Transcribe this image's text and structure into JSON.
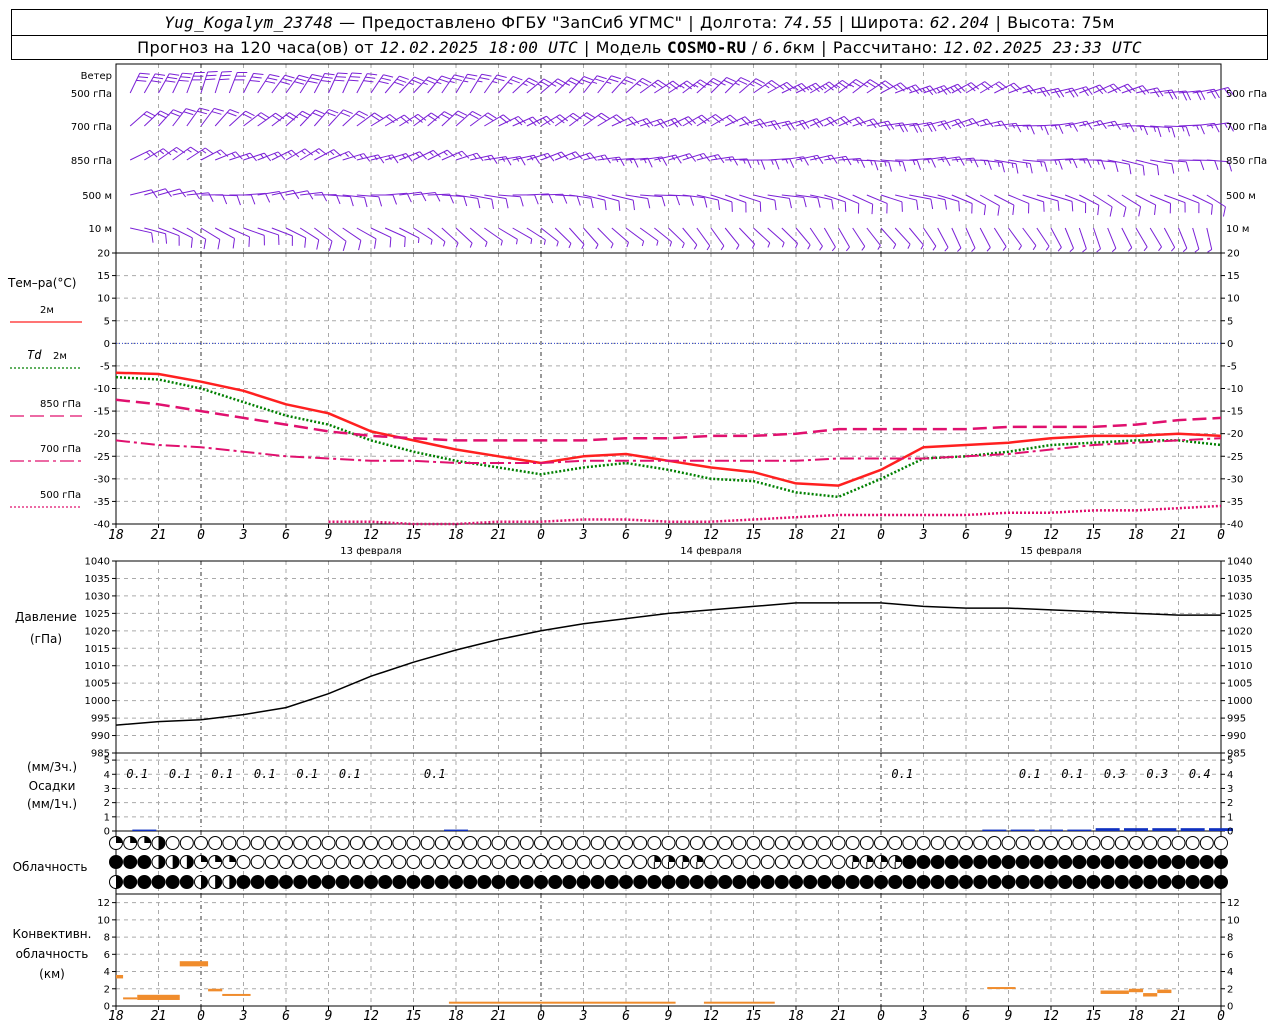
{
  "header": {
    "station": "Yug_Kogalym_23748",
    "dash": "—",
    "provider": "Предоставлено ФГБУ \"ЗапСиб УГМС\"",
    "lon_label": "Долгота:",
    "lon_value": "74.55",
    "lat_label": "Широта:",
    "lat_value": "62.204",
    "alt_label": "Высота:",
    "alt_value": "75м",
    "forecast_prefix": "Прогноз на 120 часа(ов) от",
    "forecast_time": "12.02.2025 18:00 UTC",
    "model_label": "Модель",
    "model_name": "COSMO-RU",
    "model_res": "6.6",
    "model_res_unit": "км",
    "calc_label": "Рассчитано:",
    "calc_time": "12.02.2025 23:33 UTC"
  },
  "x_axis": {
    "hour_labels": [
      "18",
      "21",
      "0",
      "3",
      "6",
      "9",
      "12",
      "15",
      "18",
      "21",
      "0",
      "3",
      "6",
      "9",
      "12",
      "15",
      "18",
      "21",
      "0",
      "3",
      "6",
      "9",
      "12",
      "15",
      "18",
      "21",
      "0"
    ],
    "day_labels": [
      {
        "text": "13 февраля",
        "at_index": 6
      },
      {
        "text": "14 февраля",
        "at_index": 14
      },
      {
        "text": "15 февраля",
        "at_index": 22
      }
    ]
  },
  "wind_panel": {
    "title": "Ветер",
    "levels": [
      "500 гПа",
      "700 гПа",
      "850 гПа",
      "500 м",
      "10  м"
    ]
  },
  "temp_panel": {
    "title": "Тем–ра(°C)",
    "legend": [
      {
        "label": "2м",
        "color": "#ff2020",
        "style": "solid"
      },
      {
        "label_main": "Td",
        "label": "2м",
        "color": "#008000",
        "style": "dotted"
      },
      {
        "label": "850 гПа",
        "color": "#e0106e",
        "style": "dashed"
      },
      {
        "label": "700 гПа",
        "color": "#e0106e",
        "style": "dashdot"
      },
      {
        "label": "500 гПа",
        "color": "#e0106e",
        "style": "dotted"
      }
    ],
    "y_ticks": [
      "20",
      "15",
      "10",
      "5",
      "0",
      "-5",
      "-10",
      "-15",
      "-20",
      "-25",
      "-30",
      "-35",
      "-40"
    ]
  },
  "pressure_panel": {
    "title": "Давление",
    "unit": "(гПа)",
    "y_ticks": [
      "1040",
      "1035",
      "1030",
      "1025",
      "1020",
      "1015",
      "1010",
      "1005",
      "1000",
      "995",
      "990",
      "985"
    ]
  },
  "precip_panel": {
    "unit_top": "(мм/3ч.)",
    "title": "Осадки",
    "unit_bottom": "(мм/1ч.)",
    "y_ticks": [
      "5",
      "4",
      "3",
      "2",
      "1",
      "0"
    ],
    "amounts": [
      {
        "text": "0.1",
        "hour": 1.5
      },
      {
        "text": "0.1",
        "hour": 4.5
      },
      {
        "text": "0.1",
        "hour": 7.5
      },
      {
        "text": "0.1",
        "hour": 10.5
      },
      {
        "text": "0.1",
        "hour": 13.5
      },
      {
        "text": "0.1",
        "hour": 16.5
      },
      {
        "text": "0.1",
        "hour": 22.5
      },
      {
        "text": "0.1",
        "hour": 55.5
      },
      {
        "text": "0.1",
        "hour": 64.5
      },
      {
        "text": "0.1",
        "hour": 67.5
      },
      {
        "text": "0.3",
        "hour": 70.5
      },
      {
        "text": "0.3",
        "hour": 73.5
      },
      {
        "text": "0.4",
        "hour": 76.5
      }
    ]
  },
  "cloud_panel": {
    "title": "Облачность"
  },
  "conv_panel": {
    "title_1": "Конвективн.",
    "title_2": "облачность",
    "unit": "(км)",
    "y_ticks": [
      "12",
      "10",
      "8",
      "6",
      "4",
      "2",
      "0"
    ]
  },
  "chart_data": [
    {
      "type": "line",
      "title": "Тем–ра(°C)",
      "x_unit": "hours from 12.02.2025 18:00 UTC",
      "x": [
        0,
        3,
        6,
        9,
        12,
        15,
        18,
        21,
        24,
        27,
        30,
        33,
        36,
        39,
        42,
        45,
        48,
        51,
        54,
        57,
        60,
        63,
        66,
        69,
        72,
        75,
        78
      ],
      "ylim": [
        -40,
        20
      ],
      "series": [
        {
          "name": "2м",
          "values": [
            -6.5,
            -6.8,
            -8.5,
            -10.5,
            -13.5,
            -15.5,
            -19.5,
            -21.5,
            -23.5,
            -25,
            -26.5,
            -25,
            -24.5,
            -26,
            -27.5,
            -28.5,
            -31,
            -31.5,
            -28,
            -23,
            -22.5,
            -22,
            -21,
            -20.5,
            -20.5,
            -20,
            -20.5
          ]
        },
        {
          "name": "Td 2м",
          "values": [
            -7.5,
            -8,
            -10,
            -13,
            -16,
            -18,
            -21.5,
            -24,
            -26,
            -27.5,
            -29,
            -27.5,
            -26.5,
            -28,
            -30,
            -30.5,
            -33,
            -34,
            -30,
            -25.5,
            -25,
            -24,
            -22.5,
            -22,
            -21.5,
            -21.5,
            -22.5
          ]
        },
        {
          "name": "850 гПа",
          "values": [
            -12.5,
            -13.5,
            -15,
            -16.5,
            -18,
            -19.5,
            -20.5,
            -21,
            -21.5,
            -21.5,
            -21.5,
            -21.5,
            -21,
            -21,
            -20.5,
            -20.5,
            -20,
            -19,
            -19,
            -19,
            -19,
            -18.5,
            -18.5,
            -18.5,
            -18,
            -17,
            -16.5
          ]
        },
        {
          "name": "700 гПа",
          "values": [
            -21.5,
            -22.5,
            -23,
            -24,
            -25,
            -25.5,
            -26,
            -26,
            -26.5,
            -26.5,
            -26.5,
            -26,
            -26,
            -26,
            -26,
            -26,
            -26,
            -25.5,
            -25.5,
            -25.5,
            -25,
            -24.5,
            -23.5,
            -22.5,
            -22,
            -21.5,
            -21
          ]
        },
        {
          "name": "500 гПа",
          "values": [
            null,
            null,
            null,
            null,
            null,
            -39.5,
            -39.5,
            -40.5,
            -40.5,
            -39.5,
            -39.5,
            -39,
            -39,
            -39.5,
            -39.5,
            -39,
            -38.5,
            -38,
            -38,
            -38,
            -38,
            -37.5,
            -37.5,
            -37,
            -37,
            -36.5,
            -36
          ]
        }
      ]
    },
    {
      "type": "line",
      "title": "Давление",
      "ylabel": "(гПа)",
      "x_unit": "hours from 12.02.2025 18:00 UTC",
      "x": [
        0,
        3,
        6,
        9,
        12,
        15,
        18,
        21,
        24,
        27,
        30,
        33,
        36,
        39,
        42,
        45,
        48,
        51,
        54,
        57,
        60,
        63,
        66,
        69,
        72,
        75,
        78
      ],
      "ylim": [
        985,
        1040
      ],
      "series": [
        {
          "name": "",
          "values": [
            993,
            994,
            994.5,
            996,
            998,
            1002,
            1007,
            1011,
            1014.5,
            1017.5,
            1020,
            1022,
            1023.5,
            1025,
            1026,
            1027,
            1028,
            1028,
            1028,
            1027,
            1026.5,
            1026.5,
            1026,
            1025.5,
            1025,
            1024.5,
            1024.5
          ]
        }
      ]
    },
    {
      "type": "bar",
      "title": "Осадки",
      "ylabel": "(мм/1ч.)",
      "x_unit": "hours from 12.02.2025 18:00 UTC",
      "ylim": [
        0,
        5
      ],
      "x": [
        2,
        24,
        62,
        64,
        66,
        68,
        70,
        72,
        74,
        76,
        78
      ],
      "values": [
        0.1,
        0.1,
        0.1,
        0.1,
        0.1,
        0.1,
        0.2,
        0.2,
        0.2,
        0.2,
        0.2
      ]
    },
    {
      "type": "bar",
      "title": "Конвективн. облачность",
      "ylabel": "(км)",
      "x_unit": "hours from 12.02.2025 18:00 UTC",
      "ylim": [
        0,
        13
      ],
      "segments": [
        {
          "x0": 0,
          "x1": 0.5,
          "bottom": 3.2,
          "top": 3.6
        },
        {
          "x0": 0.5,
          "x1": 1.5,
          "bottom": 0.8,
          "top": 1.0
        },
        {
          "x0": 1.5,
          "x1": 4.5,
          "bottom": 0.7,
          "top": 1.3
        },
        {
          "x0": 4.5,
          "x1": 6.5,
          "bottom": 4.6,
          "top": 5.2
        },
        {
          "x0": 6.5,
          "x1": 7.5,
          "bottom": 1.7,
          "top": 2.0
        },
        {
          "x0": 7.5,
          "x1": 9.5,
          "bottom": 1.2,
          "top": 1.4
        },
        {
          "x0": 23.5,
          "x1": 39.5,
          "bottom": 0.3,
          "top": 0.5
        },
        {
          "x0": 41.5,
          "x1": 46.5,
          "bottom": 0.3,
          "top": 0.5
        },
        {
          "x0": 61.5,
          "x1": 63.5,
          "bottom": 2.0,
          "top": 2.2
        },
        {
          "x0": 69.5,
          "x1": 71.5,
          "bottom": 1.4,
          "top": 1.8
        },
        {
          "x0": 71.5,
          "x1": 72.5,
          "bottom": 1.6,
          "top": 2.0
        },
        {
          "x0": 72.5,
          "x1": 73.5,
          "bottom": 1.1,
          "top": 1.5
        },
        {
          "x0": 73.5,
          "x1": 74.5,
          "bottom": 1.5,
          "top": 1.9
        }
      ]
    },
    {
      "type": "heatmap",
      "title": "Облачность",
      "x_unit": "hours from 12.02.2025 18:00 UTC, one symbol per hour",
      "rows": [
        {
          "row": "top",
          "cover_octas_segments": [
            {
              "from": 0,
              "to": 3,
              "value": 2
            },
            {
              "from": 3,
              "to": 4,
              "value": 4
            },
            {
              "from": 4,
              "to": 60,
              "value": 0
            },
            {
              "from": 60,
              "to": 78,
              "value": 0
            }
          ]
        },
        {
          "row": "middle",
          "cover_octas_segments": [
            {
              "from": 0,
              "to": 3,
              "value": 8
            },
            {
              "from": 3,
              "to": 6,
              "value": 4
            },
            {
              "from": 6,
              "to": 9,
              "value": 2
            },
            {
              "from": 9,
              "to": 38,
              "value": 0
            },
            {
              "from": 38,
              "to": 42,
              "value": 3
            },
            {
              "from": 42,
              "to": 52,
              "value": 0
            },
            {
              "from": 52,
              "to": 56,
              "value": 3
            },
            {
              "from": 56,
              "to": 78,
              "value": 8
            }
          ]
        },
        {
          "row": "bottom",
          "cover_octas_segments": [
            {
              "from": 0,
              "to": 1,
              "value": 4
            },
            {
              "from": 1,
              "to": 6,
              "value": 8
            },
            {
              "from": 6,
              "to": 9,
              "value": 4
            },
            {
              "from": 9,
              "to": 78,
              "value": 8
            }
          ]
        }
      ]
    }
  ],
  "colors": {
    "wind": "#7a1fd6",
    "temp_2m": "#ff2020",
    "td": "#008000",
    "upper": "#e0106e",
    "zero_line": "#2a40d0",
    "pressure": "#000000",
    "precip": "#1030c0",
    "conv": "#f08c2c"
  }
}
